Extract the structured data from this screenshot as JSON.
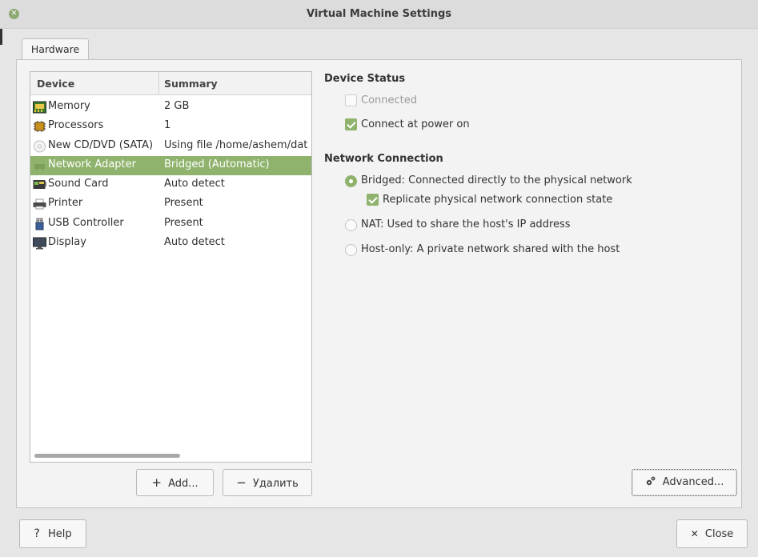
{
  "window": {
    "title": "Virtual Machine Settings"
  },
  "tabs": [
    {
      "label": "Hardware"
    }
  ],
  "device_list": {
    "columns": [
      "Device",
      "Summary"
    ],
    "rows": [
      {
        "icon": "memory-icon",
        "device": "Memory",
        "summary": "2 GB"
      },
      {
        "icon": "processor-icon",
        "device": "Processors",
        "summary": "1"
      },
      {
        "icon": "cdrom-icon",
        "device": "New CD/DVD (SATA)",
        "summary": "Using file /home/ashem/dat"
      },
      {
        "icon": "network-icon",
        "device": "Network Adapter",
        "summary": "Bridged (Automatic)",
        "selected": true
      },
      {
        "icon": "sound-card-icon",
        "device": "Sound Card",
        "summary": "Auto detect"
      },
      {
        "icon": "printer-icon",
        "device": "Printer",
        "summary": "Present"
      },
      {
        "icon": "usb-icon",
        "device": "USB Controller",
        "summary": "Present"
      },
      {
        "icon": "display-icon",
        "device": "Display",
        "summary": "Auto detect"
      }
    ]
  },
  "list_buttons": {
    "add_label": "Add...",
    "remove_label": "Удалить"
  },
  "device_status": {
    "title": "Device Status",
    "connected": {
      "label": "Connected",
      "checked": false,
      "enabled": false
    },
    "connect_at_power_on": {
      "label": "Connect at power on",
      "checked": true
    }
  },
  "network_connection": {
    "title": "Network Connection",
    "bridged": {
      "label": "Bridged: Connected directly to the physical network",
      "selected": true
    },
    "replicate": {
      "label": "Replicate physical network connection state",
      "checked": true
    },
    "nat": {
      "label": "NAT: Used to share the host's IP address",
      "selected": false
    },
    "host_only": {
      "label": "Host-only: A private network shared with the host",
      "selected": false
    }
  },
  "advanced_button": {
    "label": "Advanced..."
  },
  "footer": {
    "help_label": "Help",
    "close_label": "Close"
  },
  "colors": {
    "accent": "#8fb36c",
    "background": "#e6e6e6"
  }
}
